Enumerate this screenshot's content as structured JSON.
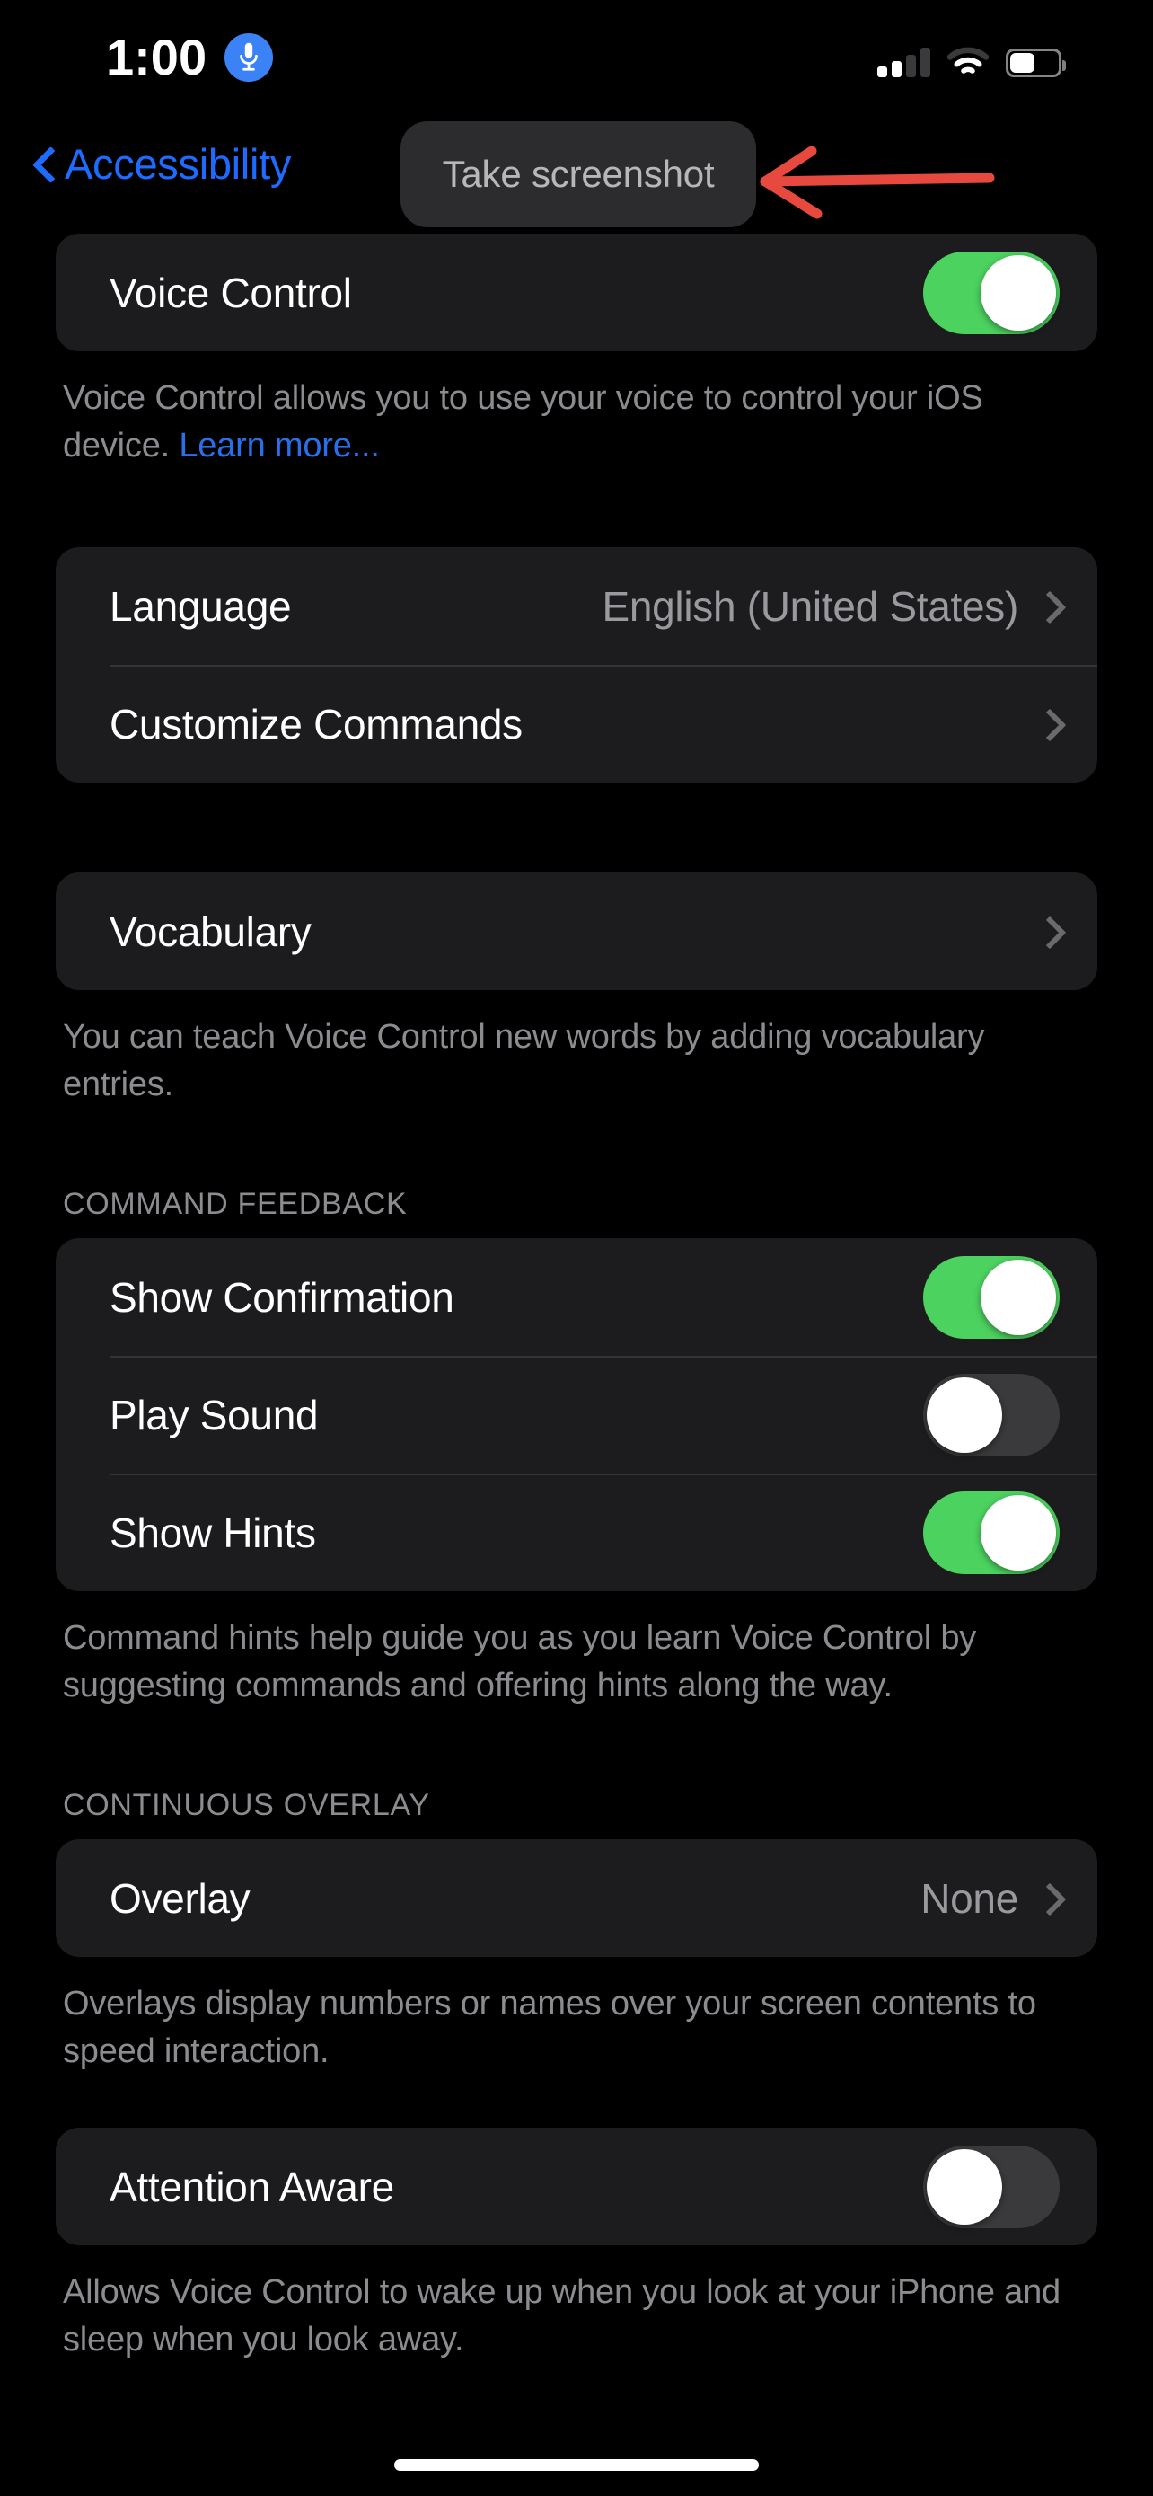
{
  "status_bar": {
    "time": "1:00",
    "mic_icon": "microphone-icon",
    "signal_icon": "cellular-signal-icon",
    "signal_bars_filled": 2,
    "signal_bars_total": 4,
    "wifi_icon": "wifi-icon",
    "battery_icon": "battery-icon",
    "battery_level_percent": 49
  },
  "nav_bar": {
    "back_label": "Accessibility",
    "back_icon": "chevron-left-icon"
  },
  "hint_bubble": {
    "label": "Take screenshot"
  },
  "annotation": {
    "arrow_icon": "left-arrow-annotation-icon",
    "color": "#e8493f"
  },
  "colors": {
    "background": "#000000",
    "card": "#1c1c1e",
    "separator": "#343436",
    "toggle_on": "#4cd25f",
    "toggle_off": "#3a3a3c",
    "accent_blue": "#1e6bff",
    "link_blue": "#2b6fe8",
    "secondary_text": "#8b8b90",
    "value_text": "#9a9a9e"
  },
  "sections": {
    "voice_control": {
      "row_label": "Voice Control",
      "toggle_state": "on",
      "footer_text": "Voice Control allows you to use your voice to control your iOS device. ",
      "footer_link": "Learn more..."
    },
    "language_group": {
      "language_label": "Language",
      "language_value": "English (United States)",
      "customize_commands_label": "Customize Commands"
    },
    "vocabulary": {
      "row_label": "Vocabulary",
      "footer_text": "You can teach Voice Control new words by adding vocabulary entries."
    },
    "command_feedback": {
      "header": "COMMAND FEEDBACK",
      "rows": [
        {
          "label": "Show Confirmation",
          "toggle_state": "on"
        },
        {
          "label": "Play Sound",
          "toggle_state": "off"
        },
        {
          "label": "Show Hints",
          "toggle_state": "on"
        }
      ],
      "footer_text": "Command hints help guide you as you learn Voice Control by suggesting commands and offering hints along the way."
    },
    "continuous_overlay": {
      "header": "CONTINUOUS OVERLAY",
      "overlay_label": "Overlay",
      "overlay_value": "None",
      "footer_text": "Overlays display numbers or names over your screen contents to speed interaction."
    },
    "attention_aware": {
      "row_label": "Attention Aware",
      "toggle_state": "off",
      "footer_text": "Allows Voice Control to wake up when you look at your iPhone and sleep when you look away."
    }
  }
}
